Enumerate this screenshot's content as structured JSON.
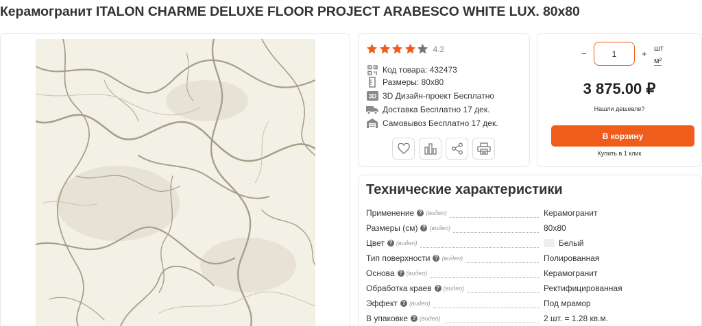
{
  "product": {
    "title": "Керамогранит ITALON CHARME DELUXE FLOOR PROJECT ARABESCO WHITE LUX. 80x80"
  },
  "rating": {
    "value": "4.2",
    "stars_filled": 4,
    "stars_total": 5,
    "star_color": "#f05c1b",
    "star_empty_color": "#777777"
  },
  "info": {
    "items": [
      {
        "icon": "qr-code-icon",
        "text": "Код товара: 432473"
      },
      {
        "icon": "ruler-icon",
        "text": "Размеры: 80x80"
      },
      {
        "icon": "3d-icon",
        "text": "3D Дизайн-проект Бесплатно",
        "icon_label": "3D"
      },
      {
        "icon": "delivery-truck-icon",
        "text": "Доставка Бесплатно 17 дек."
      },
      {
        "icon": "store-pickup-icon",
        "text": "Самовывоз Бесплатно 17 дек."
      }
    ],
    "actions": [
      {
        "name": "favorite-button",
        "icon": "heart-icon"
      },
      {
        "name": "compare-button",
        "icon": "bar-chart-icon"
      },
      {
        "name": "share-button",
        "icon": "share-icon"
      },
      {
        "name": "print-button",
        "icon": "printer-icon"
      }
    ]
  },
  "purchase": {
    "minus": "−",
    "plus": "+",
    "quantity": "1",
    "unit_pcs": "шт",
    "unit_m2": "м²",
    "price": "3 875.00 ₽",
    "cheaper_link": "Нашли дешевле?",
    "cart_button": "В корзину",
    "one_click": "Купить в 1 клик",
    "accent_color": "#f05c1b"
  },
  "specs": {
    "title": "Технические характеристики",
    "video_label": "(видео)",
    "help_icon": "?",
    "rows": [
      {
        "name": "Применение",
        "value": "Керамогранит"
      },
      {
        "name": "Размеры (см)",
        "value": "80x80"
      },
      {
        "name": "Цвет",
        "value": "Белый",
        "swatch": "#eeeeee"
      },
      {
        "name": "Тип поверхности",
        "value": "Полированная"
      },
      {
        "name": "Основа",
        "value": "Керамогранит"
      },
      {
        "name": "Обработка краев",
        "value": "Ректифицированная"
      },
      {
        "name": "Эффект",
        "value": "Под мрамор"
      },
      {
        "name": "В упаковке",
        "value": "2 шт. = 1.28 кв.м."
      }
    ]
  }
}
